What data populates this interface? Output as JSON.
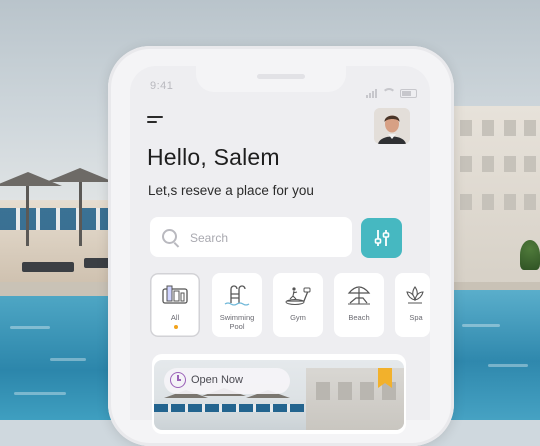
{
  "status_bar": {
    "time": "9:41"
  },
  "header": {
    "menu_icon": "hamburger-menu-icon",
    "avatar": "user-avatar",
    "greeting": "Hello, Salem",
    "subtitle": "Let,s reseve a place for you"
  },
  "search": {
    "placeholder": "Search",
    "icon": "search-icon",
    "filter_icon": "sliders-icon"
  },
  "colors": {
    "accent": "#46b8c1",
    "active_dot": "#f2a31c",
    "bookmark": "#f2b12c",
    "clock": "#9b62b8"
  },
  "categories": [
    {
      "label": "All",
      "icon": "all-places-icon",
      "selected": true
    },
    {
      "label": "Swimming Pool",
      "icon": "pool-ladder-icon",
      "selected": false
    },
    {
      "label": "Gym",
      "icon": "treadmill-icon",
      "selected": false
    },
    {
      "label": "Beach",
      "icon": "beach-umbrella-icon",
      "selected": false
    },
    {
      "label": "Spa",
      "icon": "lotus-icon",
      "selected": false
    }
  ],
  "card": {
    "status": "Open Now",
    "status_icon": "clock-icon",
    "bookmark_icon": "bookmark-icon"
  }
}
